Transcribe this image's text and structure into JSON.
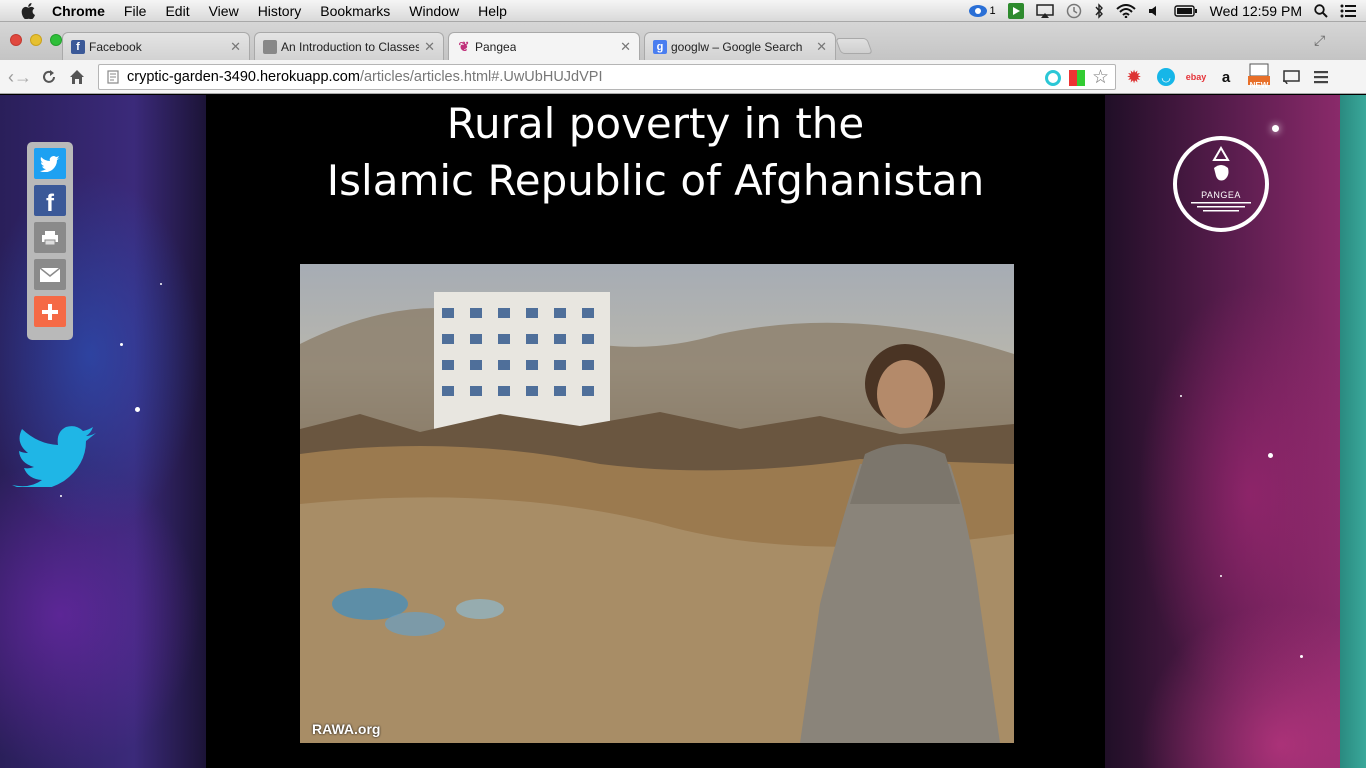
{
  "menubar": {
    "app": "Chrome",
    "items": [
      "File",
      "Edit",
      "View",
      "History",
      "Bookmarks",
      "Window",
      "Help"
    ],
    "badge_count": "1",
    "clock": "Wed 12:59 PM"
  },
  "tabs": [
    {
      "title": "Facebook",
      "favicon": "f",
      "favicon_color": "#3b5998"
    },
    {
      "title": "An Introduction to Classes",
      "favicon": "",
      "favicon_color": "#777777"
    },
    {
      "title": "Pangea",
      "favicon": "",
      "favicon_color": "#c0307a"
    },
    {
      "title": "googlw – Google Search",
      "favicon": "g",
      "favicon_color": "#4a7ef0"
    }
  ],
  "address": {
    "host": "cryptic-garden-3490.herokuapp.com",
    "path": "/articles/articles.html#.UwUbHUJdVPI"
  },
  "extensions": {
    "new_badge": "NEW"
  },
  "page": {
    "title_line1": "Rural poverty in the",
    "title_line2": "Islamic Republic of Afghanistan",
    "photo_credit": "RAWA.org",
    "logo_text": "PANGEA"
  },
  "colors": {
    "twitter": "#1da1f2",
    "facebook": "#3b5998",
    "print": "#8a8a8a",
    "email": "#8a8a8a",
    "more": "#f56a46",
    "twitter_bird": "#1fb6e6"
  }
}
